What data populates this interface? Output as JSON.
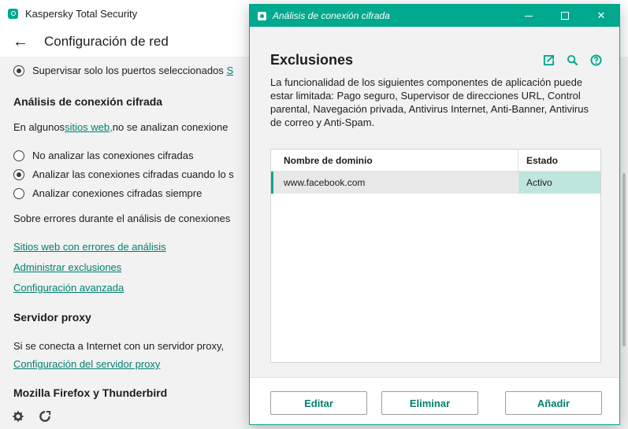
{
  "app": {
    "title": "Kaspersky Total Security",
    "page_title": "Configuración de red"
  },
  "main": {
    "monitor_selected_ports": "Supervisar solo los puertos seleccionados",
    "monitor_link_fragment": "S",
    "encrypted_section_title": "Análisis de conexión cifrada",
    "encrypted_intro_before": "En algunos ",
    "encrypted_intro_link": "sitios web,",
    "encrypted_intro_after": " no se analizan conexione",
    "radio_options": [
      {
        "label": "No analizar las conexiones cifradas",
        "checked": false
      },
      {
        "label": "Analizar las conexiones cifradas cuando lo s",
        "checked": true
      },
      {
        "label": "Analizar conexiones cifradas siempre",
        "checked": false
      }
    ],
    "errors_text": "Sobre errores durante el análisis de conexiones",
    "links": {
      "sites_with_errors": "Sitios web con errores de análisis",
      "manage_exclusions": "Administrar exclusiones",
      "advanced_settings": "Configuración avanzada"
    },
    "proxy_section_title": "Servidor proxy",
    "proxy_text": "Si se conecta a Internet con un servidor proxy,",
    "proxy_link": "Configuración del servidor proxy",
    "firefox_section_title": "Mozilla Firefox y Thunderbird"
  },
  "dialog": {
    "title": "Análisis de conexión cifrada",
    "heading": "Exclusiones",
    "description": "La funcionalidad de los siguientes componentes de aplicación puede estar limitada: Pago seguro, Supervisor de direcciones URL, Control parental, Navegación privada, Antivirus Internet, Anti-Banner, Antivirus de correo y Anti-Spam.",
    "table": {
      "columns": [
        "Nombre de dominio",
        "Estado"
      ],
      "rows": [
        {
          "domain": "www.facebook.com",
          "status": "Activo"
        }
      ]
    },
    "buttons": {
      "edit": "Editar",
      "delete": "Eliminar",
      "add": "Añadir"
    },
    "window_controls": {
      "close": "✕"
    }
  },
  "colors": {
    "accent": "#00a88e",
    "link": "#00806e",
    "selected_status_bg": "#bfe6dd"
  }
}
